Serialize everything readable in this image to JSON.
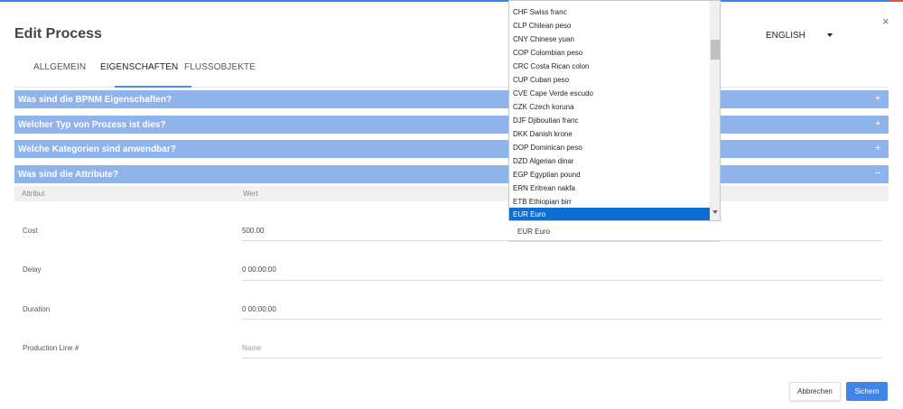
{
  "dialog": {
    "title": "Edit Process",
    "close_glyph": "×"
  },
  "language": {
    "selected": "ENGLISH"
  },
  "tabs": [
    {
      "label": "ALLGEMEIN"
    },
    {
      "label": "EIGENSCHAFTEN",
      "active": true
    },
    {
      "label": "FLUSSOBJEKTE"
    }
  ],
  "sections": [
    {
      "label": "Was sind die BPNM Eigenschaften?",
      "toggle": "+"
    },
    {
      "label": "Welcher Typ von Prozess ist dies?",
      "toggle": "+"
    },
    {
      "label": "Welche Kategorien sind anwendbar?",
      "toggle": "+"
    },
    {
      "label": "Was sind die Attribute?",
      "toggle": "−"
    }
  ],
  "attributes": {
    "header": {
      "attribute": "Attribut",
      "value": "Wert"
    },
    "rows": [
      {
        "label": "Cost",
        "value": "500.00"
      },
      {
        "label": "Delay",
        "value": "0 00:00:00"
      },
      {
        "label": "Duration",
        "value": "0 00:00:00"
      },
      {
        "label": "Production Line #",
        "placeholder": "Name"
      }
    ]
  },
  "currency": {
    "selected": "EUR Euro",
    "options": [
      "CHF Swiss franc",
      "CLP Chilean peso",
      "CNY Chinese yuan",
      "COP Colombian peso",
      "CRC Costa Rican colon",
      "CUP Cuban peso",
      "CVE Cape Verde escudo",
      "CZK Czech koruna",
      "DJF Djiboutian franc",
      "DKK Danish krone",
      "DOP Dominican peso",
      "DZD Algerian dinar",
      "EGP Egyptian pound",
      "ERN Eritrean nakfa",
      "ETB Ethiopian birr",
      "EUR Euro"
    ]
  },
  "buttons": {
    "cancel": "Abbrechen",
    "save": "Sichern"
  },
  "colors": {
    "accent": "#3f85e8",
    "section_bg": "#8fb3eb",
    "selected_option": "#0b6ed0"
  }
}
